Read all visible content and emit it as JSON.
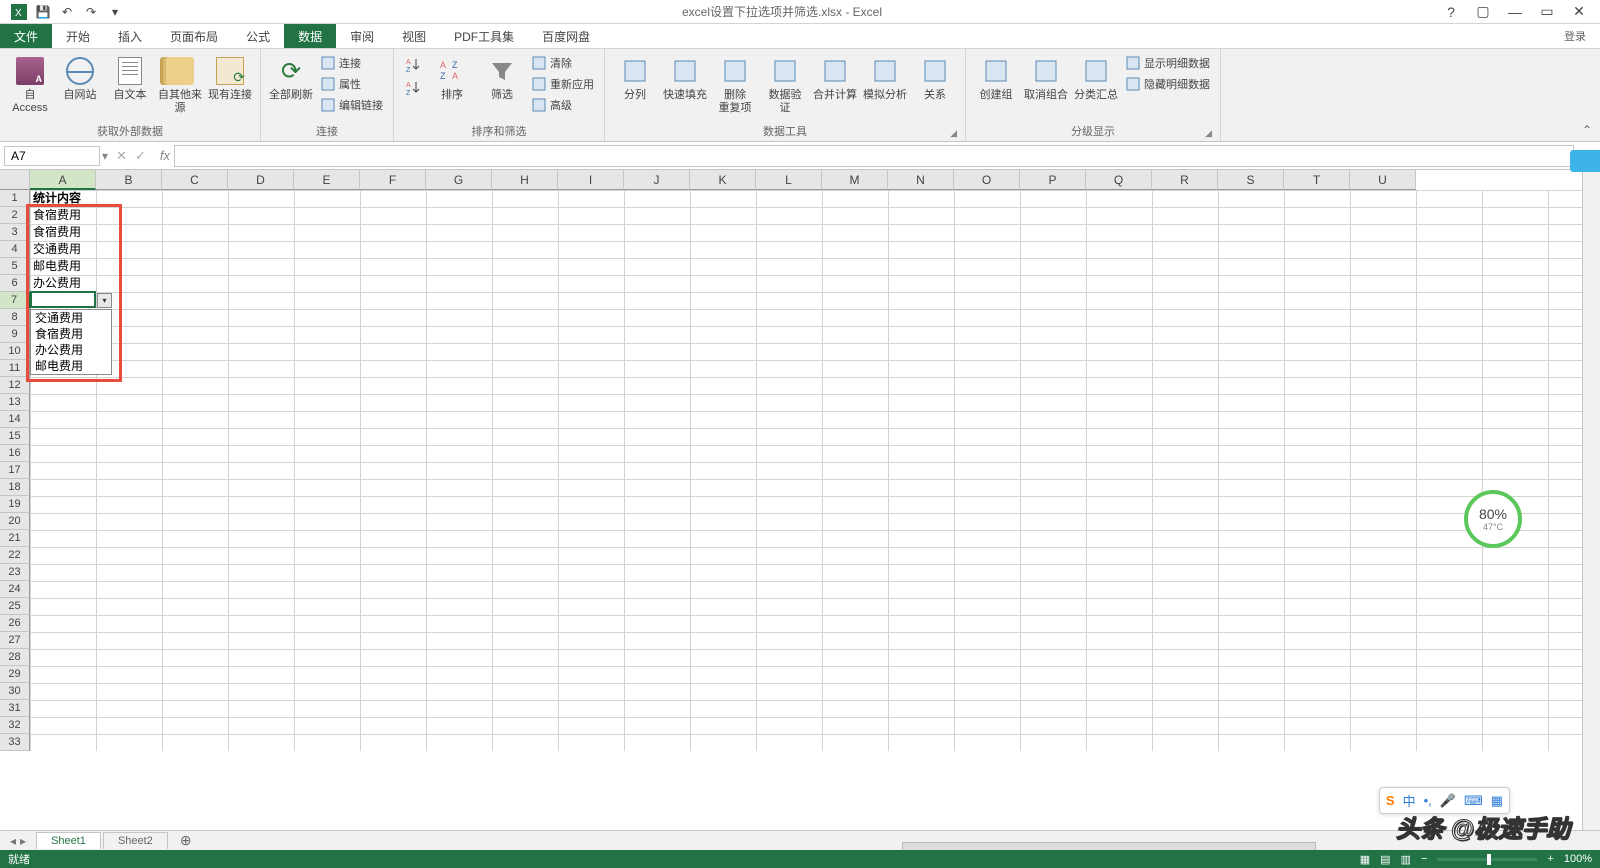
{
  "title": "excel设置下拉选项并筛选.xlsx - Excel",
  "login": "登录",
  "menu": [
    "文件",
    "开始",
    "插入",
    "页面布局",
    "公式",
    "数据",
    "审阅",
    "视图",
    "PDF工具集",
    "百度网盘"
  ],
  "active_menu": "数据",
  "ribbon": {
    "groups": [
      {
        "label": "获取外部数据",
        "launcher": false,
        "items_large": [
          {
            "name": "from-access",
            "label": "自 Access"
          },
          {
            "name": "from-web",
            "label": "自网站"
          },
          {
            "name": "from-text",
            "label": "自文本"
          },
          {
            "name": "from-other",
            "label": "自其他来源"
          },
          {
            "name": "existing-conn",
            "label": "现有连接"
          }
        ]
      },
      {
        "label": "连接",
        "launcher": false,
        "items_large": [
          {
            "name": "refresh-all",
            "label": "全部刷新"
          }
        ],
        "items_small": [
          {
            "icon": "link-icon",
            "label": "连接"
          },
          {
            "icon": "properties-icon",
            "label": "属性"
          },
          {
            "icon": "edit-links-icon",
            "label": "编辑链接"
          }
        ]
      },
      {
        "label": "排序和筛选",
        "launcher": false,
        "prefix_small": [
          {
            "icon": "sort-asc-icon",
            "label": ""
          },
          {
            "icon": "sort-desc-icon",
            "label": ""
          }
        ],
        "items_large": [
          {
            "name": "sort",
            "label": "排序"
          },
          {
            "name": "filter",
            "label": "筛选"
          }
        ],
        "items_small": [
          {
            "icon": "clear-icon",
            "label": "清除"
          },
          {
            "icon": "reapply-icon",
            "label": "重新应用"
          },
          {
            "icon": "advanced-icon",
            "label": "高级"
          }
        ]
      },
      {
        "label": "数据工具",
        "launcher": true,
        "items_large": [
          {
            "name": "text-to-columns",
            "label": "分列"
          },
          {
            "name": "flash-fill",
            "label": "快速填充"
          },
          {
            "name": "remove-dup",
            "label": "删除\n重复项"
          },
          {
            "name": "data-validation",
            "label": "数据验\n证"
          },
          {
            "name": "consolidate",
            "label": "合并计算"
          },
          {
            "name": "what-if",
            "label": "模拟分析"
          },
          {
            "name": "relationships",
            "label": "关系"
          }
        ]
      },
      {
        "label": "分级显示",
        "launcher": true,
        "items_large": [
          {
            "name": "group",
            "label": "创建组"
          },
          {
            "name": "ungroup",
            "label": "取消组合"
          },
          {
            "name": "subtotal",
            "label": "分类汇总"
          }
        ],
        "items_small": [
          {
            "icon": "show-detail-icon",
            "label": "显示明细数据"
          },
          {
            "icon": "hide-detail-icon",
            "label": "隐藏明细数据"
          }
        ]
      }
    ]
  },
  "name_box": "A7",
  "columns": [
    "A",
    "B",
    "C",
    "D",
    "E",
    "F",
    "G",
    "H",
    "I",
    "J",
    "K",
    "L",
    "M",
    "N",
    "O",
    "P",
    "Q",
    "R",
    "S",
    "T",
    "U"
  ],
  "row_count": 33,
  "selected_row": 7,
  "selected_col": 0,
  "cells": {
    "A1": "统计内容",
    "A2": "食宿费用",
    "A3": "食宿费用",
    "A4": "交通费用",
    "A5": "邮电费用",
    "A6": "办公费用"
  },
  "dropdown_options": [
    "交通费用",
    "食宿费用",
    "办公费用",
    "邮电费用"
  ],
  "sheets": [
    "Sheet1",
    "Sheet2"
  ],
  "active_sheet": 0,
  "status": "就绪",
  "zoom": "100%",
  "gauge": {
    "percent": "80%",
    "temp": "47°C"
  },
  "ime": {
    "lang": "中"
  },
  "watermark": "头条 @极速手助"
}
